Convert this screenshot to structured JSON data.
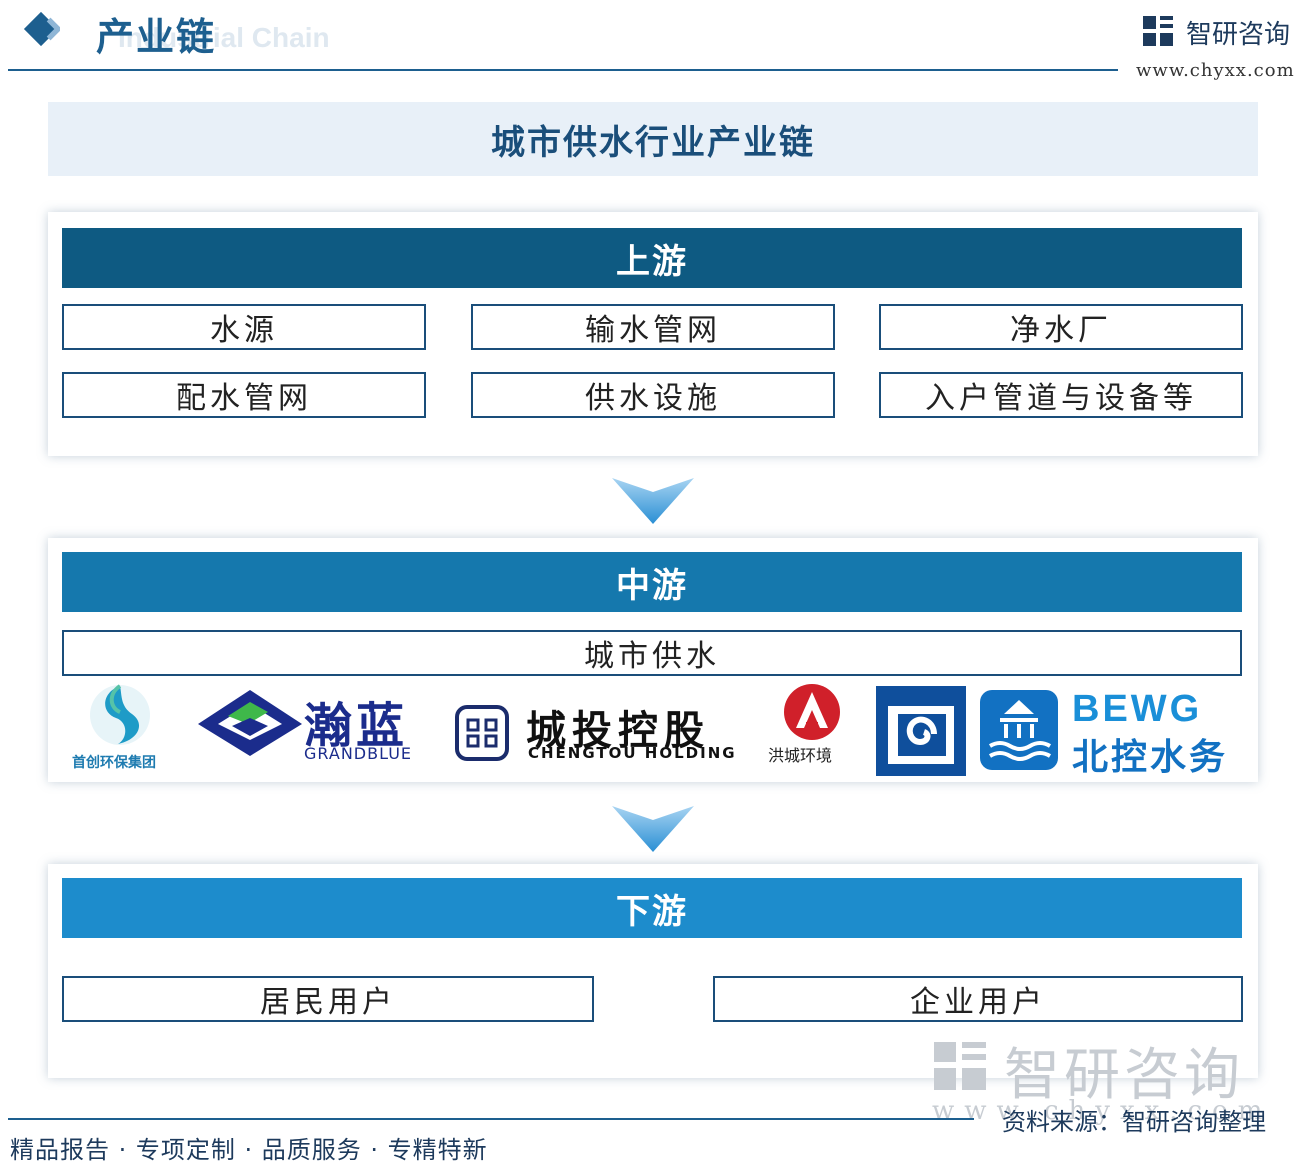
{
  "header": {
    "title": "产业链",
    "subtitle": "Industrial Chain",
    "brand_name": "智研咨询",
    "brand_url": "www.chyxx.com"
  },
  "diagram": {
    "title": "城市供水行业产业链",
    "upstream": {
      "label": "上游",
      "items": [
        "水源",
        "输水管网",
        "净水厂",
        "配水管网",
        "供水设施",
        "入户管道与设备等"
      ]
    },
    "midstream": {
      "label": "中游",
      "items": [
        "城市供水"
      ],
      "companies": {
        "shouchuang": "首创环保集团",
        "grandblue_cn": "瀚蓝",
        "grandblue_en": "GRANDBLUE",
        "chengtou_cn": "城投控股",
        "chengtou_en": "CHENGTOU HOLDING",
        "hongcheng": "洪城环境",
        "bewg_en": "BEWG",
        "bewg_cn": "北控水务"
      }
    },
    "downstream": {
      "label": "下游",
      "items": [
        "居民用户",
        "企业用户"
      ]
    }
  },
  "watermark": {
    "name": "智研咨询",
    "url": "www.chyxx.com"
  },
  "footer": {
    "tagline": "精品报告 · 专项定制 · 品质服务 · 专精特新",
    "source": "资料来源：智研咨询整理"
  },
  "colors": {
    "upstream_bar": "#0e5a82",
    "midstream_bar": "#1578ad",
    "downstream_bar": "#1d8ccc",
    "title_band": "#e8f0f8"
  }
}
